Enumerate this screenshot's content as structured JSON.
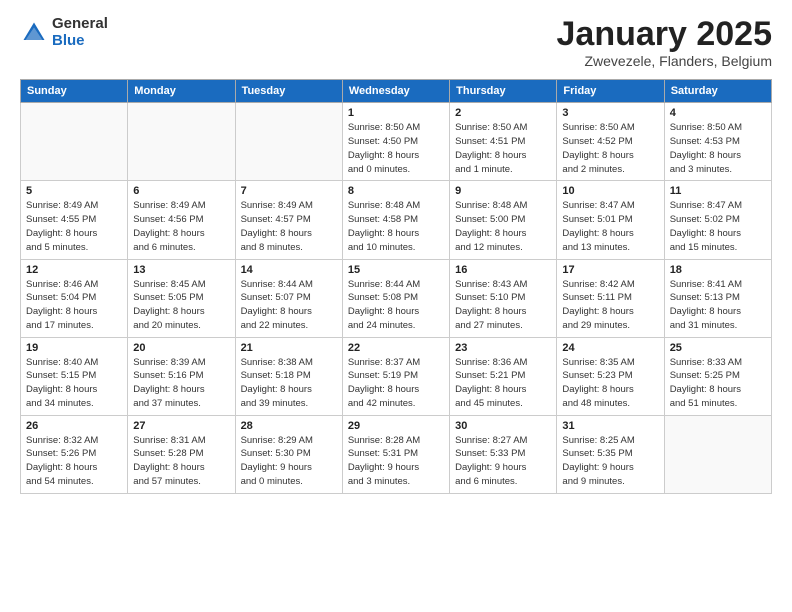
{
  "logo": {
    "general": "General",
    "blue": "Blue"
  },
  "header": {
    "month": "January 2025",
    "location": "Zwevezele, Flanders, Belgium"
  },
  "weekdays": [
    "Sunday",
    "Monday",
    "Tuesday",
    "Wednesday",
    "Thursday",
    "Friday",
    "Saturday"
  ],
  "weeks": [
    [
      {
        "day": "",
        "info": ""
      },
      {
        "day": "",
        "info": ""
      },
      {
        "day": "",
        "info": ""
      },
      {
        "day": "1",
        "info": "Sunrise: 8:50 AM\nSunset: 4:50 PM\nDaylight: 8 hours\nand 0 minutes."
      },
      {
        "day": "2",
        "info": "Sunrise: 8:50 AM\nSunset: 4:51 PM\nDaylight: 8 hours\nand 1 minute."
      },
      {
        "day": "3",
        "info": "Sunrise: 8:50 AM\nSunset: 4:52 PM\nDaylight: 8 hours\nand 2 minutes."
      },
      {
        "day": "4",
        "info": "Sunrise: 8:50 AM\nSunset: 4:53 PM\nDaylight: 8 hours\nand 3 minutes."
      }
    ],
    [
      {
        "day": "5",
        "info": "Sunrise: 8:49 AM\nSunset: 4:55 PM\nDaylight: 8 hours\nand 5 minutes."
      },
      {
        "day": "6",
        "info": "Sunrise: 8:49 AM\nSunset: 4:56 PM\nDaylight: 8 hours\nand 6 minutes."
      },
      {
        "day": "7",
        "info": "Sunrise: 8:49 AM\nSunset: 4:57 PM\nDaylight: 8 hours\nand 8 minutes."
      },
      {
        "day": "8",
        "info": "Sunrise: 8:48 AM\nSunset: 4:58 PM\nDaylight: 8 hours\nand 10 minutes."
      },
      {
        "day": "9",
        "info": "Sunrise: 8:48 AM\nSunset: 5:00 PM\nDaylight: 8 hours\nand 12 minutes."
      },
      {
        "day": "10",
        "info": "Sunrise: 8:47 AM\nSunset: 5:01 PM\nDaylight: 8 hours\nand 13 minutes."
      },
      {
        "day": "11",
        "info": "Sunrise: 8:47 AM\nSunset: 5:02 PM\nDaylight: 8 hours\nand 15 minutes."
      }
    ],
    [
      {
        "day": "12",
        "info": "Sunrise: 8:46 AM\nSunset: 5:04 PM\nDaylight: 8 hours\nand 17 minutes."
      },
      {
        "day": "13",
        "info": "Sunrise: 8:45 AM\nSunset: 5:05 PM\nDaylight: 8 hours\nand 20 minutes."
      },
      {
        "day": "14",
        "info": "Sunrise: 8:44 AM\nSunset: 5:07 PM\nDaylight: 8 hours\nand 22 minutes."
      },
      {
        "day": "15",
        "info": "Sunrise: 8:44 AM\nSunset: 5:08 PM\nDaylight: 8 hours\nand 24 minutes."
      },
      {
        "day": "16",
        "info": "Sunrise: 8:43 AM\nSunset: 5:10 PM\nDaylight: 8 hours\nand 27 minutes."
      },
      {
        "day": "17",
        "info": "Sunrise: 8:42 AM\nSunset: 5:11 PM\nDaylight: 8 hours\nand 29 minutes."
      },
      {
        "day": "18",
        "info": "Sunrise: 8:41 AM\nSunset: 5:13 PM\nDaylight: 8 hours\nand 31 minutes."
      }
    ],
    [
      {
        "day": "19",
        "info": "Sunrise: 8:40 AM\nSunset: 5:15 PM\nDaylight: 8 hours\nand 34 minutes."
      },
      {
        "day": "20",
        "info": "Sunrise: 8:39 AM\nSunset: 5:16 PM\nDaylight: 8 hours\nand 37 minutes."
      },
      {
        "day": "21",
        "info": "Sunrise: 8:38 AM\nSunset: 5:18 PM\nDaylight: 8 hours\nand 39 minutes."
      },
      {
        "day": "22",
        "info": "Sunrise: 8:37 AM\nSunset: 5:19 PM\nDaylight: 8 hours\nand 42 minutes."
      },
      {
        "day": "23",
        "info": "Sunrise: 8:36 AM\nSunset: 5:21 PM\nDaylight: 8 hours\nand 45 minutes."
      },
      {
        "day": "24",
        "info": "Sunrise: 8:35 AM\nSunset: 5:23 PM\nDaylight: 8 hours\nand 48 minutes."
      },
      {
        "day": "25",
        "info": "Sunrise: 8:33 AM\nSunset: 5:25 PM\nDaylight: 8 hours\nand 51 minutes."
      }
    ],
    [
      {
        "day": "26",
        "info": "Sunrise: 8:32 AM\nSunset: 5:26 PM\nDaylight: 8 hours\nand 54 minutes."
      },
      {
        "day": "27",
        "info": "Sunrise: 8:31 AM\nSunset: 5:28 PM\nDaylight: 8 hours\nand 57 minutes."
      },
      {
        "day": "28",
        "info": "Sunrise: 8:29 AM\nSunset: 5:30 PM\nDaylight: 9 hours\nand 0 minutes."
      },
      {
        "day": "29",
        "info": "Sunrise: 8:28 AM\nSunset: 5:31 PM\nDaylight: 9 hours\nand 3 minutes."
      },
      {
        "day": "30",
        "info": "Sunrise: 8:27 AM\nSunset: 5:33 PM\nDaylight: 9 hours\nand 6 minutes."
      },
      {
        "day": "31",
        "info": "Sunrise: 8:25 AM\nSunset: 5:35 PM\nDaylight: 9 hours\nand 9 minutes."
      },
      {
        "day": "",
        "info": ""
      }
    ]
  ]
}
